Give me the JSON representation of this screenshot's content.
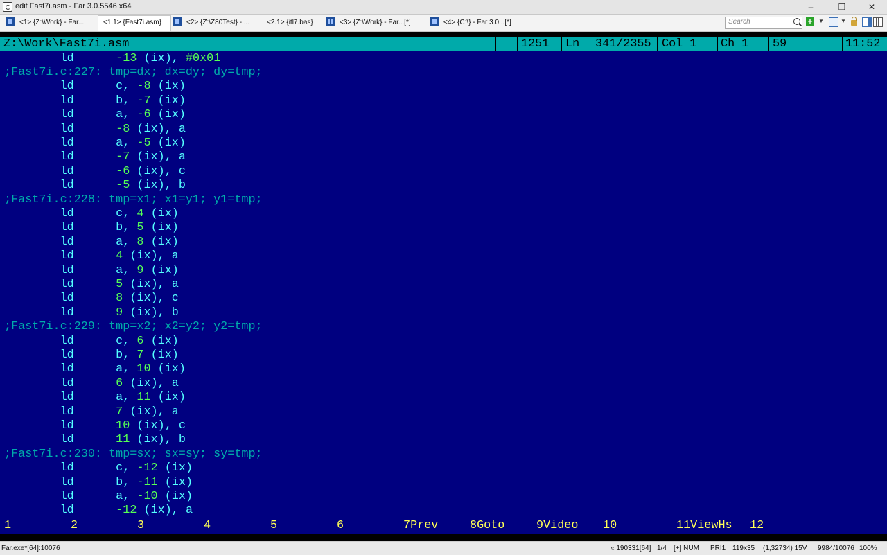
{
  "window": {
    "title": "edit Fast7i.asm - Far 3.0.5546 x64",
    "min_glyph": "–",
    "max_glyph": "❐",
    "close_glyph": "✕"
  },
  "tabs": [
    {
      "label": "<1> {Z:\\Work} - Far...",
      "icon": "far-console-icon"
    },
    {
      "label": "<1.1> {Fast7i.asm}",
      "icon": "",
      "active": true
    },
    {
      "label": "<2> {Z:\\Z80Test} - ...",
      "icon": "far-console-icon"
    },
    {
      "label": "<2.1> {itl7.bas}",
      "icon": ""
    },
    {
      "label": "<3> {Z:\\Work} - Far...[*]",
      "icon": "far-console-icon"
    },
    {
      "label": "<4> {C:\\} - Far 3.0...[*]",
      "icon": "far-console-icon"
    }
  ],
  "toolbar": {
    "search_placeholder": "Search",
    "icons": [
      "search-icon",
      "plus-icon",
      "grid-icon",
      "lock-icon",
      "panel-icon",
      "columns-icon"
    ],
    "plus_glyph": "+",
    "dropdown_glyph": "▼"
  },
  "editor_status": {
    "path": "Z:\\Work\\Fast7i.asm",
    "code": "1251",
    "line_label": "Ln",
    "line_value": "341/2355",
    "col": "Col 1",
    "ch": "Ch 1",
    "char_code": "59",
    "clock": "11:52"
  },
  "code_lines": [
    {
      "kind": "instr",
      "text": "        ld      -13 (ix), #0x01"
    },
    {
      "kind": "comment",
      "text": ";Fast7i.c:227: tmp=dx; dx=dy; dy=tmp;"
    },
    {
      "kind": "instr",
      "text": "        ld      c, -8 (ix)"
    },
    {
      "kind": "instr",
      "text": "        ld      b, -7 (ix)"
    },
    {
      "kind": "instr",
      "text": "        ld      a, -6 (ix)"
    },
    {
      "kind": "instr",
      "text": "        ld      -8 (ix), a"
    },
    {
      "kind": "instr",
      "text": "        ld      a, -5 (ix)"
    },
    {
      "kind": "instr",
      "text": "        ld      -7 (ix), a"
    },
    {
      "kind": "instr",
      "text": "        ld      -6 (ix), c"
    },
    {
      "kind": "instr",
      "text": "        ld      -5 (ix), b"
    },
    {
      "kind": "comment",
      "text": ";Fast7i.c:228: tmp=x1; x1=y1; y1=tmp;"
    },
    {
      "kind": "instr",
      "text": "        ld      c, 4 (ix)"
    },
    {
      "kind": "instr",
      "text": "        ld      b, 5 (ix)"
    },
    {
      "kind": "instr",
      "text": "        ld      a, 8 (ix)"
    },
    {
      "kind": "instr",
      "text": "        ld      4 (ix), a"
    },
    {
      "kind": "instr",
      "text": "        ld      a, 9 (ix)"
    },
    {
      "kind": "instr",
      "text": "        ld      5 (ix), a"
    },
    {
      "kind": "instr",
      "text": "        ld      8 (ix), c"
    },
    {
      "kind": "instr",
      "text": "        ld      9 (ix), b"
    },
    {
      "kind": "comment",
      "text": ";Fast7i.c:229: tmp=x2; x2=y2; y2=tmp;"
    },
    {
      "kind": "instr",
      "text": "        ld      c, 6 (ix)"
    },
    {
      "kind": "instr",
      "text": "        ld      b, 7 (ix)"
    },
    {
      "kind": "instr",
      "text": "        ld      a, 10 (ix)"
    },
    {
      "kind": "instr",
      "text": "        ld      6 (ix), a"
    },
    {
      "kind": "instr",
      "text": "        ld      a, 11 (ix)"
    },
    {
      "kind": "instr",
      "text": "        ld      7 (ix), a"
    },
    {
      "kind": "instr",
      "text": "        ld      10 (ix), c"
    },
    {
      "kind": "instr",
      "text": "        ld      11 (ix), b"
    },
    {
      "kind": "comment",
      "text": ";Fast7i.c:230: tmp=sx; sx=sy; sy=tmp;"
    },
    {
      "kind": "instr",
      "text": "        ld      c, -12 (ix)"
    },
    {
      "kind": "instr",
      "text": "        ld      b, -11 (ix)"
    },
    {
      "kind": "instr",
      "text": "        ld      a, -10 (ix)"
    },
    {
      "kind": "instr",
      "text": "        ld      -12 (ix), a"
    }
  ],
  "keybar": [
    {
      "num": "1",
      "label": ""
    },
    {
      "num": "2",
      "label": ""
    },
    {
      "num": "3",
      "label": ""
    },
    {
      "num": "4",
      "label": ""
    },
    {
      "num": "5",
      "label": ""
    },
    {
      "num": "6",
      "label": ""
    },
    {
      "num": "7",
      "label": "Prev"
    },
    {
      "num": "8",
      "label": "Goto"
    },
    {
      "num": "9",
      "label": "Video"
    },
    {
      "num": "10",
      "label": ""
    },
    {
      "num": "11",
      "label": "ViewHs"
    },
    {
      "num": "12",
      "label": ""
    }
  ],
  "statusbar": {
    "process": "Far.exe*[64]:10076",
    "pos": "« 190331[64]",
    "page": "1/4",
    "modes": "[+] NUM",
    "pri": "PRI1",
    "size": "119x35",
    "coords": "(1,32734) 15V",
    "mem": "9984/10076",
    "zoom": "100%"
  },
  "colors": {
    "editor_bg": "#000080",
    "status_bg": "#00aaaa",
    "operand": "#55ffff",
    "number": "#55ff55",
    "comment": "#00aaaa",
    "key_number": "#ffff55"
  }
}
